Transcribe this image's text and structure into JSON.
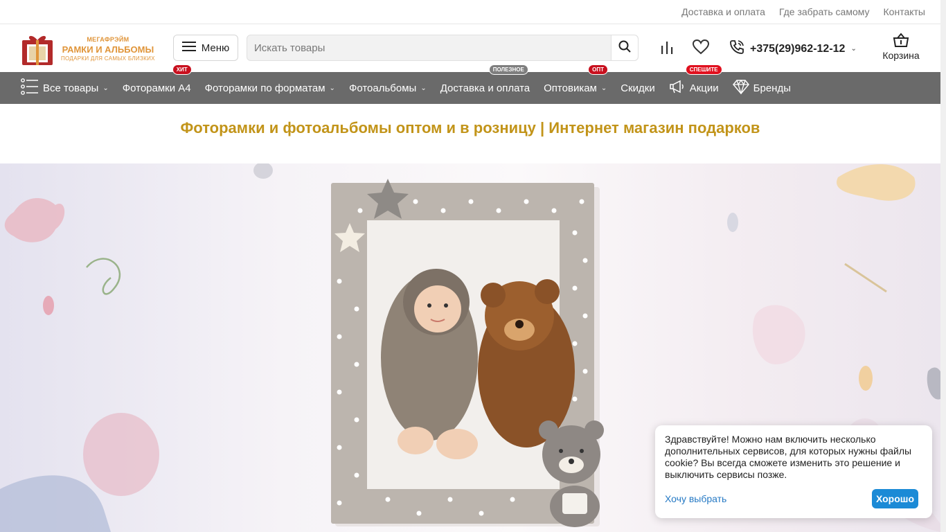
{
  "topbar": {
    "links": [
      "Доставка и оплата",
      "Где забрать самому",
      "Контакты"
    ]
  },
  "logo": {
    "small": "МЕГАФРЭЙМ",
    "main": "РАМКИ И АЛЬБОМЫ",
    "sub": "ПОДАРКИ ДЛЯ САМЫХ БЛИЗКИХ"
  },
  "header": {
    "menu_label": "Меню",
    "search_placeholder": "Искать товары",
    "phone": "+375(29)962-12-12",
    "cart_label": "Корзина",
    "compare_icon": "bar-chart-icon",
    "favorites_icon": "heart-icon"
  },
  "nav": {
    "items": [
      {
        "label": "Все товары",
        "dropdown": true
      },
      {
        "label": "Фоторамки А4",
        "badge": "ХИТ",
        "badge_color": "#c8101e"
      },
      {
        "label": "Фоторамки по форматам",
        "dropdown": true
      },
      {
        "label": "Фотоальбомы",
        "dropdown": true
      },
      {
        "label": "Доставка и оплата",
        "badge": "ПОЛЕЗНОЕ",
        "badge_color": "#7e7e7e"
      },
      {
        "label": "Оптовикам",
        "badge": "ОПТ",
        "badge_color": "#c8101e",
        "dropdown": true
      },
      {
        "label": "Скидки"
      },
      {
        "label": "Акции",
        "badge": "СПЕШИТЕ",
        "badge_color": "#e0101e"
      },
      {
        "label": "Бренды"
      }
    ]
  },
  "page": {
    "title": "Фоторамки и фотоальбомы оптом и в розницу | Интернет магазин подарков"
  },
  "cookie": {
    "text": "Здравствуйте! Можно нам включить несколько дополнительных сервисов, для которых нужны файлы cookie? Вы всегда сможете изменить это решение и выключить сервисы позже.",
    "choose_label": "Хочу выбрать",
    "ok_label": "Хорошо"
  },
  "colors": {
    "nav_bg": "#6a6a6a",
    "title_gold": "#c29419",
    "accent_blue": "#1b8ad6",
    "logo_orange": "#e0953a"
  }
}
